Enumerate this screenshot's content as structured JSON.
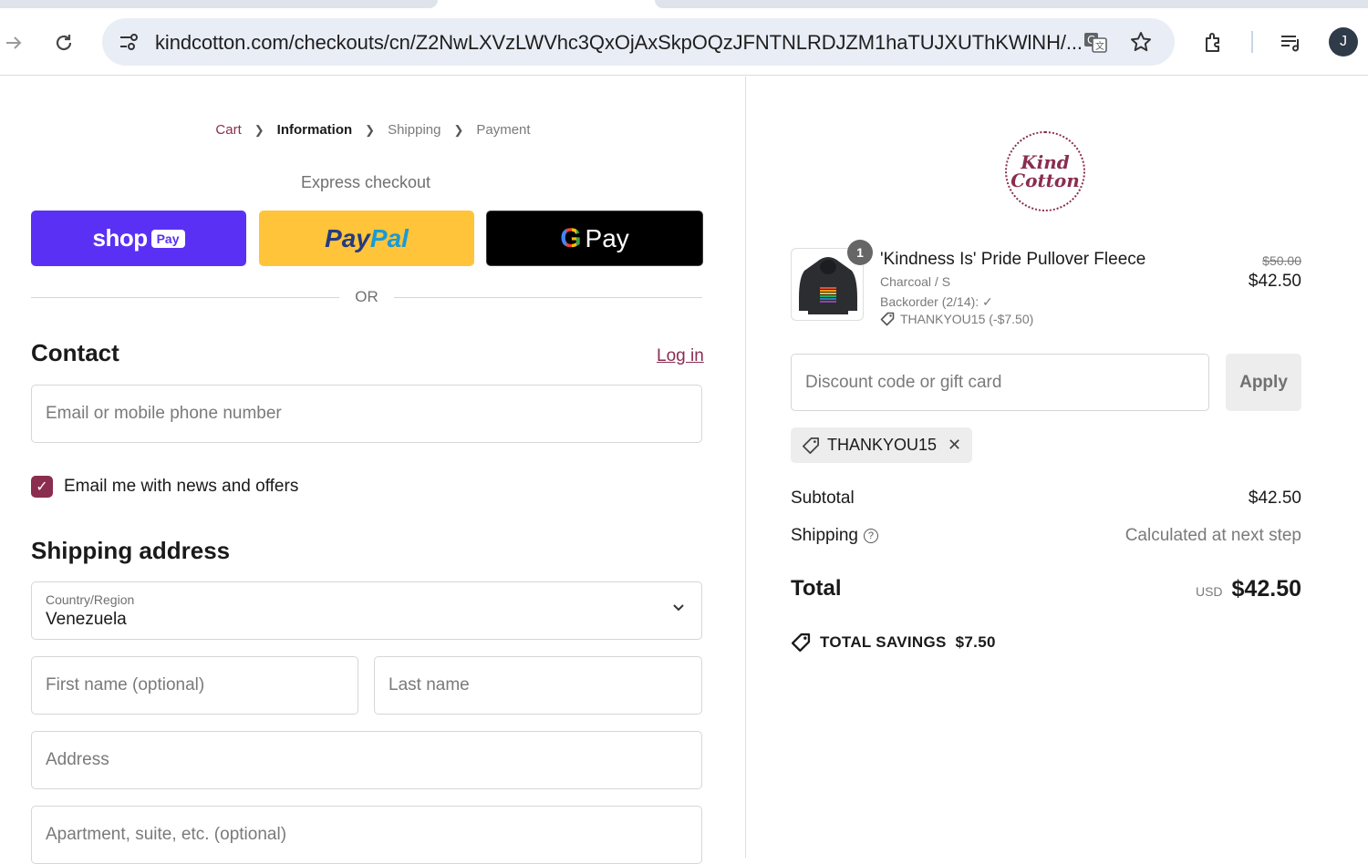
{
  "browser": {
    "url": "kindcotton.com/checkouts/cn/Z2NwLXVzLWVhc3QxOjAxSkpOQzJFNTNLRDJZM1haTUJXUThKWlNH/...",
    "avatar_letter": "J"
  },
  "breadcrumb": {
    "cart": "Cart",
    "information": "Information",
    "shipping": "Shipping",
    "payment": "Payment"
  },
  "express": {
    "label": "Express checkout",
    "shop_word": "shop",
    "shop_pay": "Pay",
    "paypal_part1": "Pay",
    "paypal_part2": "Pal",
    "gpay_g": "G",
    "gpay_word": "Pay",
    "or": "OR"
  },
  "contact": {
    "title": "Contact",
    "login": "Log in",
    "email_placeholder": "Email or mobile phone number",
    "newsletter_label": "Email me with news and offers",
    "newsletter_checked": true
  },
  "shipping_address": {
    "title": "Shipping address",
    "country_label": "Country/Region",
    "country_value": "Venezuela",
    "first_name_placeholder": "First name (optional)",
    "last_name_placeholder": "Last name",
    "address_placeholder": "Address",
    "apartment_placeholder": "Apartment, suite, etc. (optional)"
  },
  "summary": {
    "logo_line1": "Kind",
    "logo_line2": "Cotton",
    "item": {
      "quantity": "1",
      "name": "'Kindness Is' Pride Pullover Fleece",
      "variant": "Charcoal / S",
      "backorder": "Backorder (2/14): ✓",
      "discount": "THANKYOU15 (-$7.50)",
      "price_original": "$50.00",
      "price_final": "$42.50"
    },
    "discount_placeholder": "Discount code or gift card",
    "apply_label": "Apply",
    "applied_code": "THANKYOU15",
    "subtotal_label": "Subtotal",
    "subtotal_value": "$42.50",
    "shipping_label": "Shipping",
    "shipping_value": "Calculated at next step",
    "total_label": "Total",
    "total_currency": "USD",
    "total_value": "$42.50",
    "savings_label": "TOTAL SAVINGS",
    "savings_value": "$7.50"
  },
  "colors": {
    "brand": "#8a2d4f",
    "shop_pay": "#5a31f4",
    "paypal": "#ffc439"
  }
}
